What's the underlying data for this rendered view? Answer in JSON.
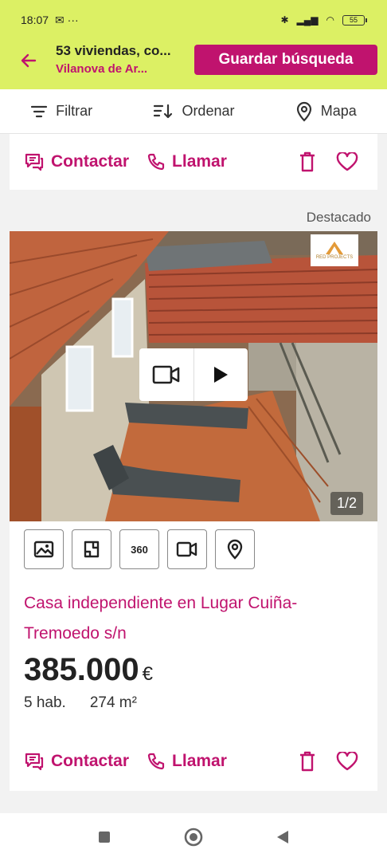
{
  "status_bar": {
    "time": "18:07",
    "left_extra": "✉ ···",
    "battery": "55"
  },
  "header": {
    "title": "53 viviendas, co...",
    "subtitle": "Vilanova de Ar...",
    "save_search_label": "Guardar búsqueda"
  },
  "filter_bar": {
    "filter_label": "Filtrar",
    "sort_label": "Ordenar",
    "map_label": "Mapa"
  },
  "previous_card": {
    "contact_label": "Contactar",
    "call_label": "Llamar"
  },
  "listing": {
    "featured_label": "Destacado",
    "photo_counter": "1/2",
    "agency_logo_text": "RED PROJECTS",
    "media_tabs": [
      "photos",
      "plan",
      "360",
      "video",
      "map"
    ],
    "media_tab_360_label": "360",
    "title": "Casa independiente en Lugar Cuiña-Tremoedo s/n",
    "price": "385.000",
    "currency": "€",
    "rooms": "5 hab.",
    "area": "274 m²",
    "contact_label": "Contactar",
    "call_label": "Llamar"
  },
  "colors": {
    "accent": "#c0136e",
    "header_bg": "#dcf064"
  },
  "icons": {
    "back": "arrow-left-icon",
    "filter": "filter-lines-icon",
    "sort": "sort-icon",
    "map": "location-pin-icon",
    "contact": "chat-icon",
    "call": "phone-icon",
    "delete": "trash-icon",
    "favorite": "heart-icon"
  }
}
